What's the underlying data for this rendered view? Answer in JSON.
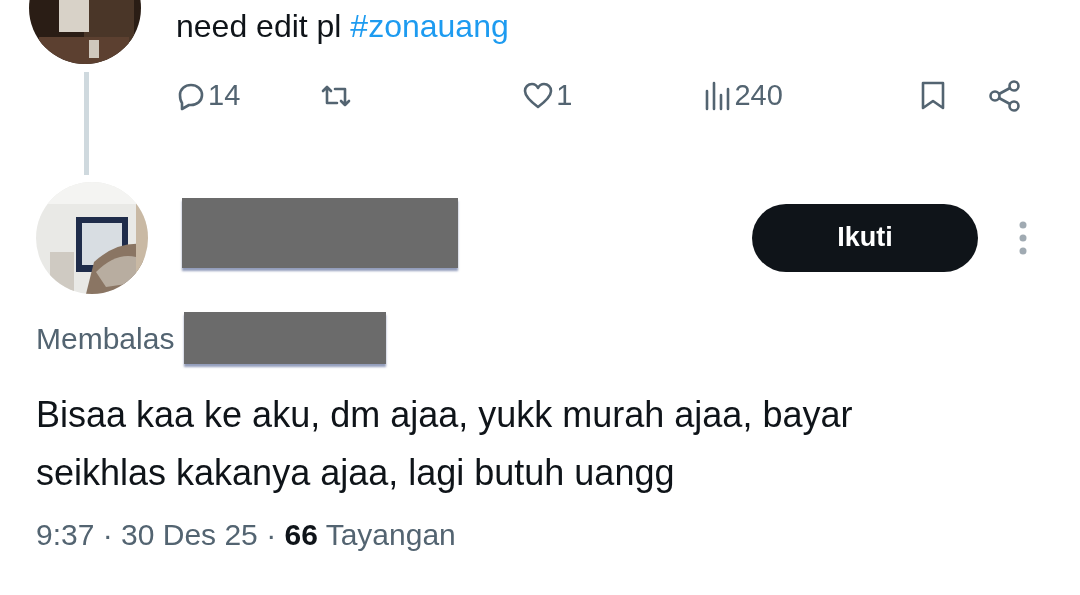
{
  "parent_tweet": {
    "text": "need edit pl",
    "hashtag": "#zonauang",
    "actions": [
      {
        "kind": "reply",
        "count": "14"
      },
      {
        "kind": "retweet"
      },
      {
        "kind": "like",
        "count": "1"
      },
      {
        "kind": "views",
        "count": "240"
      },
      {
        "kind": "bookmark"
      },
      {
        "kind": "share"
      }
    ]
  },
  "reply": {
    "follow_button": "Ikuti",
    "replying_to": "Membalas",
    "text": "Bisaa kaa ke aku, dm ajaa, yukk murah ajaa, bayar seikhlas kakanya ajaa, lagi butuh uangg",
    "meta": "9:37 · 30 Des 25 · **66** Tayangan"
  }
}
